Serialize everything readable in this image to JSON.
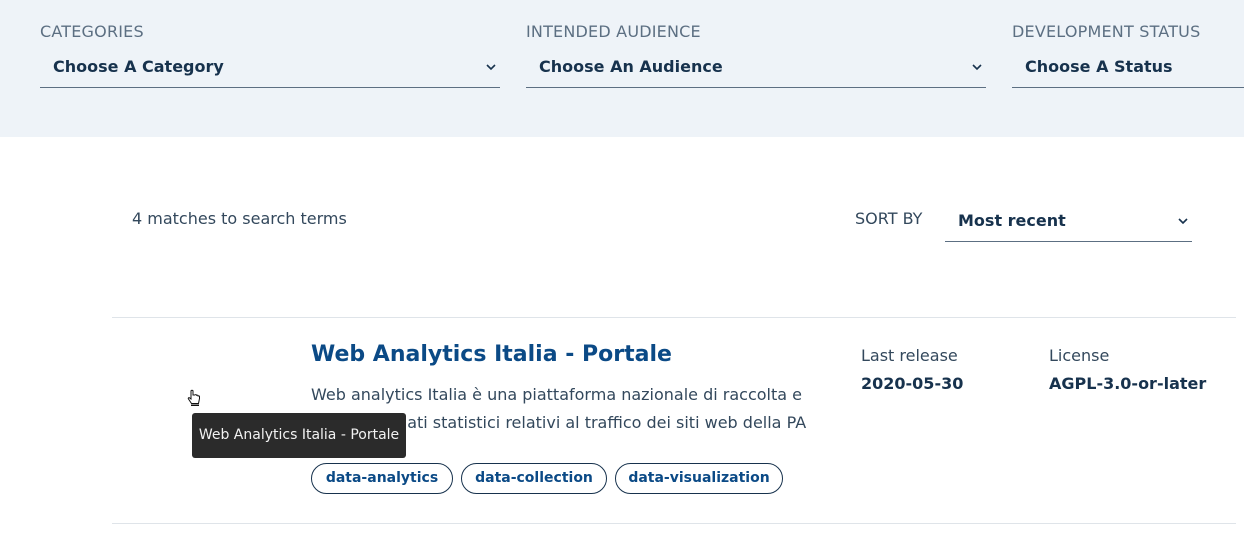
{
  "filters": [
    {
      "label": "CATEGORIES",
      "value": "Choose A Category"
    },
    {
      "label": "INTENDED AUDIENCE",
      "value": "Choose An Audience"
    },
    {
      "label": "DEVELOPMENT STATUS",
      "value": "Choose A Status"
    }
  ],
  "results": {
    "count_text": "4 matches to search terms",
    "sort_label": "SORT BY",
    "sort_value": "Most recent"
  },
  "item": {
    "title": "Web Analytics Italia - Portale",
    "description": "Web analytics Italia è una piattaforma nazionale di raccolta e analisi dei dati statistici relativi al traffico dei siti web della PA italiana.",
    "last_release_label": "Last release",
    "last_release_value": "2020-05-30",
    "license_label": "License",
    "license_value": "AGPL-3.0-or-later",
    "tags": [
      "data-analytics",
      "data-collection",
      "data-visualization"
    ]
  },
  "tooltip": "Web Analytics Italia - Portale",
  "icons": {
    "chevron": "chevron-down-icon",
    "cursor": "hand-pointer-icon"
  },
  "colors": {
    "filter_band": "#eef3f8",
    "title_blue": "#0b4a86",
    "text_dark": "#17324d",
    "tooltip_bg": "#2b2b2b"
  }
}
